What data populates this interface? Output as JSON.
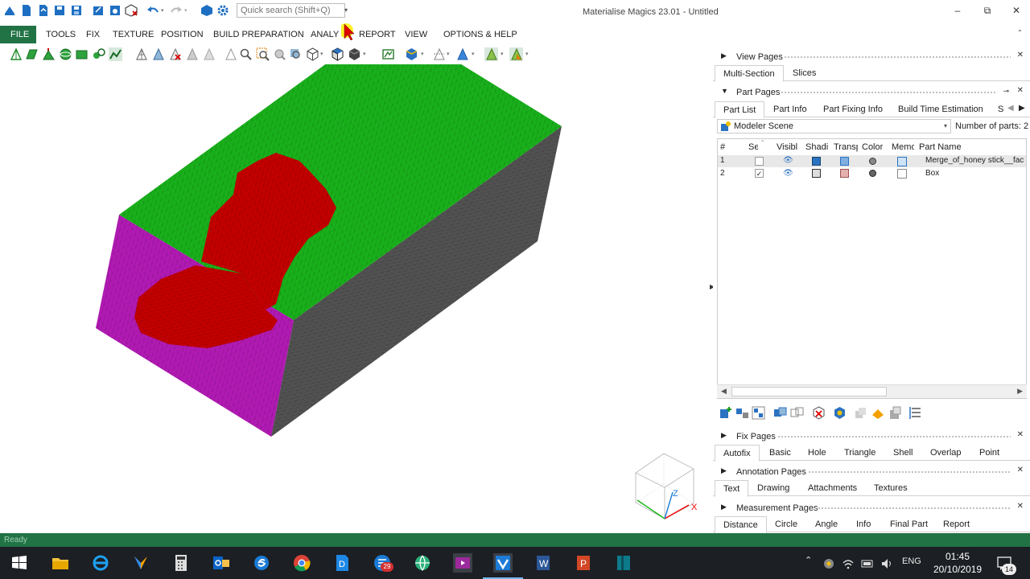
{
  "app": {
    "window_title": "Materialise Magics 23.01 - Untitled"
  },
  "search": {
    "placeholder": "Quick search (Shift+Q)"
  },
  "window_controls": {
    "minimize": "–",
    "restore": "⧉",
    "close": "✕"
  },
  "menu": {
    "items": [
      "FILE",
      "TOOLS",
      "FIX",
      "TEXTURE",
      "POSITION",
      "BUILD PREPARATION",
      "ANALY",
      "REPORT",
      "VIEW",
      "OPTIONS & HELP"
    ],
    "active": "FILE",
    "accent_color": "#217346"
  },
  "right_panel": {
    "view_pages": {
      "title": "View Pages",
      "tabs": [
        "Multi-Section",
        "Slices"
      ],
      "active_tab": "Multi-Section"
    },
    "part_pages": {
      "title": "Part Pages",
      "tabs": [
        "Part List",
        "Part Info",
        "Part Fixing Info",
        "Build Time Estimation",
        "Sc"
      ],
      "active_tab": "Part List",
      "scene_select": "Modeler Scene",
      "number_of_parts_label": "Number of parts: 2",
      "columns": [
        "#",
        "Se",
        "Visibl",
        "Shadi",
        "Transp",
        "Color",
        "Memo",
        "Part Name"
      ],
      "rows": [
        {
          "index": "1",
          "selected": false,
          "part_name": "Merge_of_honey stick__fac",
          "highlight": true
        },
        {
          "index": "2",
          "selected": true,
          "part_name": "Box",
          "highlight": false
        }
      ]
    },
    "fix_pages": {
      "title": "Fix Pages",
      "tabs": [
        "Autofix",
        "Basic",
        "Hole",
        "Triangle",
        "Shell",
        "Overlap",
        "Point"
      ],
      "active_tab": "Autofix"
    },
    "annotation_pages": {
      "title": "Annotation Pages",
      "tabs": [
        "Text",
        "Drawing",
        "Attachments",
        "Textures"
      ],
      "active_tab": "Text"
    },
    "measurement_pages": {
      "title": "Measurement Pages",
      "tabs": [
        "Distance",
        "Circle",
        "Angle",
        "Info",
        "Final Part",
        "Report"
      ],
      "active_tab": "Distance"
    }
  },
  "viewport": {
    "model_colors": {
      "top": "#19b11b",
      "front": "#b21ab4",
      "side": "#525252",
      "insert": "#c40000"
    },
    "axis_labels": {
      "x": "X",
      "z": "Z"
    }
  },
  "status": {
    "text": "Ready"
  },
  "taskbar": {
    "language": "ENG",
    "time": "01:45",
    "date": "20/10/2019",
    "notification_count": "14",
    "chat_badge": "29"
  }
}
